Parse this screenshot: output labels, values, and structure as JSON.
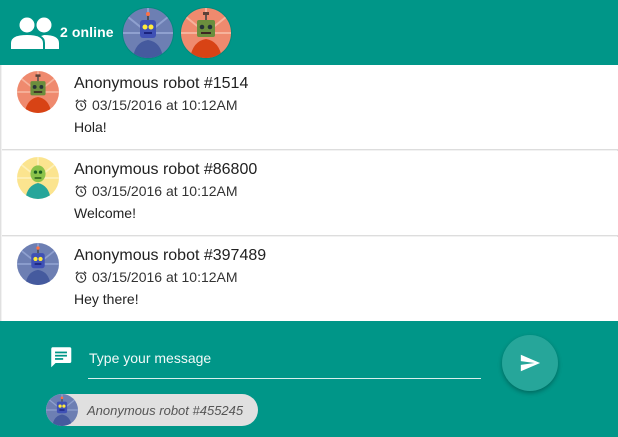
{
  "header": {
    "online_count_label": "2 online",
    "online_users": [
      {
        "avatar": "robot-blue-avatar"
      },
      {
        "avatar": "robot-orange-avatar"
      }
    ]
  },
  "messages": [
    {
      "author": "Anonymous robot #1514",
      "timestamp": "03/15/2016 at 10:12AM",
      "text": "Hola!",
      "avatar": "robot-orange-avatar"
    },
    {
      "author": "Anonymous robot #86800",
      "timestamp": "03/15/2016 at 10:12AM",
      "text": "Welcome!",
      "avatar": "robot-yellow-avatar"
    },
    {
      "author": "Anonymous robot #397489",
      "timestamp": "03/15/2016 at 10:12AM",
      "text": "Hey there!",
      "avatar": "robot-blue-avatar"
    }
  ],
  "compose": {
    "placeholder": "Type your message",
    "value": "",
    "current_user": "Anonymous robot #455245"
  },
  "colors": {
    "primary": "#009688",
    "accent_button": "#26a69a",
    "chip": "#e0e0e0"
  },
  "icons": {
    "online": "people-icon",
    "timestamp": "alarm-clock-icon",
    "compose": "chat-bubble-icon",
    "send": "send-icon"
  }
}
